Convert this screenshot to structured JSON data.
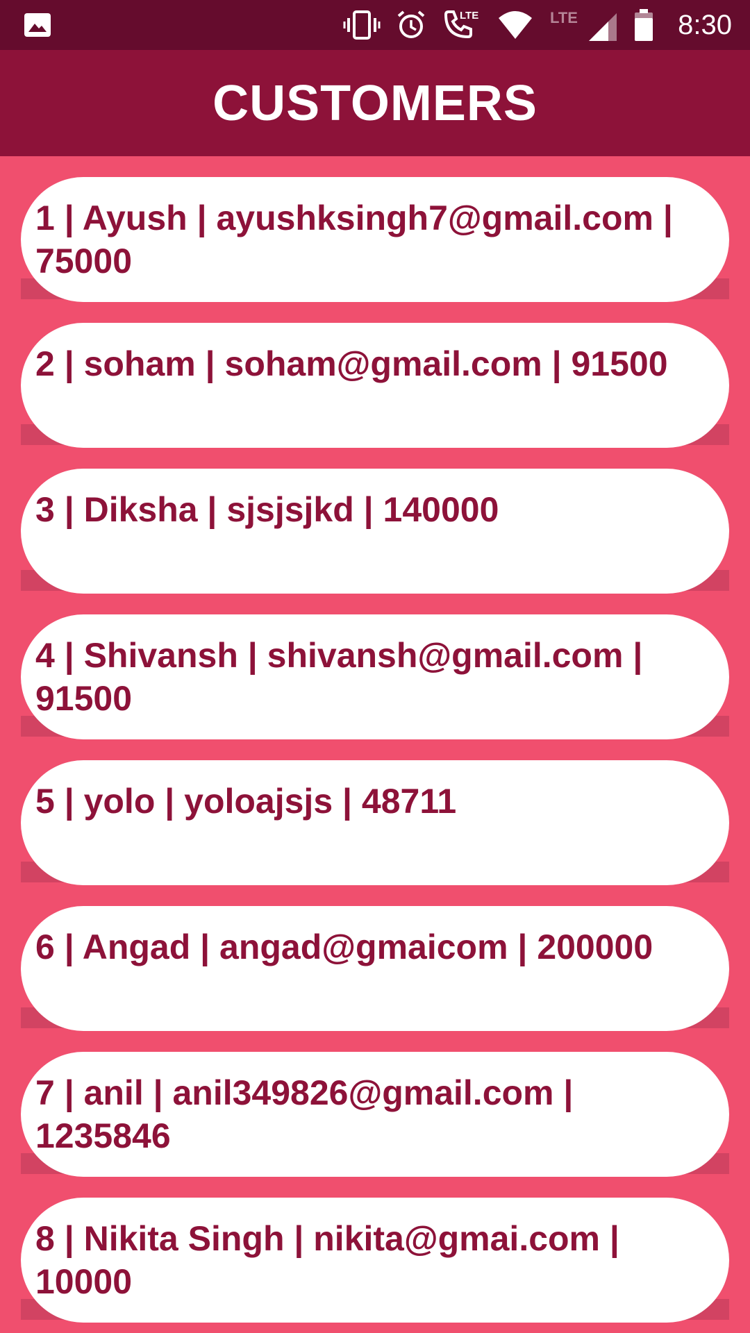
{
  "status_bar": {
    "time": "8:30",
    "lte_label": "LTE",
    "icons": [
      "image-icon",
      "vibrate-icon",
      "alarm-icon",
      "volte-call-icon",
      "wifi-icon",
      "lte-signal-icon",
      "battery-icon"
    ]
  },
  "app_bar": {
    "title": "CUSTOMERS"
  },
  "colors": {
    "status_bar": "#650c2d",
    "app_bar": "#8d1239",
    "background": "#f04f6e",
    "divider": "#d24362",
    "card": "#ffffff",
    "card_text": "#8d1239"
  },
  "customers": [
    {
      "text": "1 | Ayush | ayushksingh7@gmail.com | 75000"
    },
    {
      "text": "2 | soham | soham@gmail.com | 91500"
    },
    {
      "text": "3 | Diksha | sjsjsjkd | 140000"
    },
    {
      "text": "4 | Shivansh | shivansh@gmail.com | 91500"
    },
    {
      "text": "5 | yolo | yoloajsjs | 48711"
    },
    {
      "text": "6 | Angad | angad@gmaicom | 200000"
    },
    {
      "text": "7 | anil | anil349826@gmail.com | 1235846"
    },
    {
      "text": "8 | Nikita Singh | nikita@gmai.com | 10000"
    }
  ]
}
